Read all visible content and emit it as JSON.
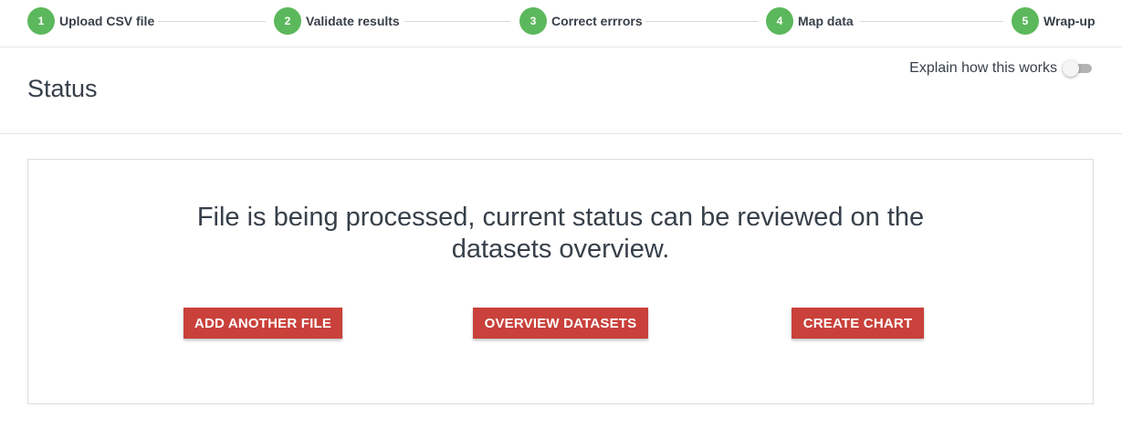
{
  "stepper": {
    "steps": [
      {
        "number": "1",
        "label": "Upload CSV file"
      },
      {
        "number": "2",
        "label": "Validate results"
      },
      {
        "number": "3",
        "label": "Correct errrors"
      },
      {
        "number": "4",
        "label": "Map data"
      },
      {
        "number": "5",
        "label": "Wrap-up"
      }
    ],
    "step_color": "#5cb85c"
  },
  "header": {
    "title": "Status",
    "explain_label": "Explain how this works",
    "explain_toggle_on": false
  },
  "main": {
    "message": "File is being processed, current status can be reviewed on the datasets overview.",
    "buttons": {
      "add_file": "ADD ANOTHER FILE",
      "overview": "OVERVIEW DATASETS",
      "create_chart": "CREATE CHART"
    },
    "button_color": "#c9413a"
  }
}
